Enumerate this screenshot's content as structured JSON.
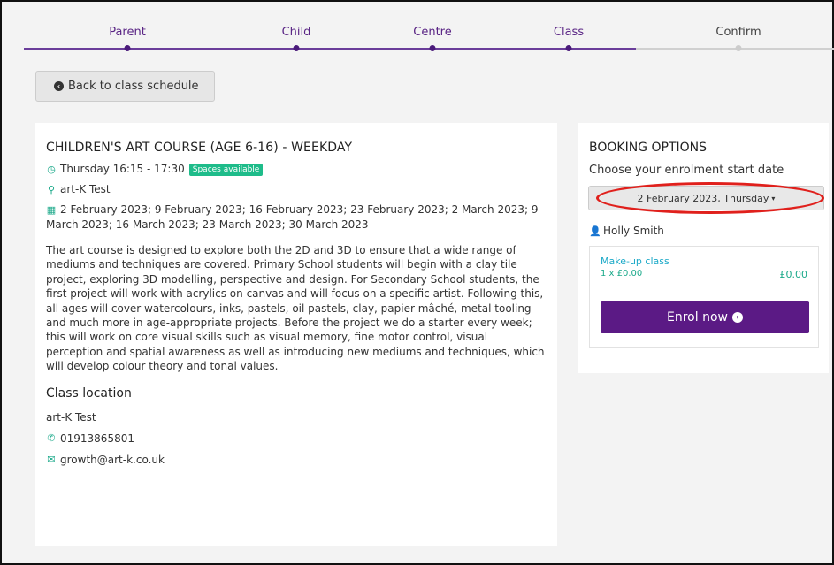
{
  "stepper": {
    "steps": [
      {
        "label": "Parent"
      },
      {
        "label": "Child"
      },
      {
        "label": "Centre"
      },
      {
        "label": "Class"
      },
      {
        "label": "Confirm"
      }
    ]
  },
  "back_button": {
    "label": "Back to class schedule"
  },
  "course": {
    "title": "CHILDREN'S ART COURSE (AGE 6-16) - WEEKDAY",
    "time": "Thursday 16:15 - 17:30",
    "availability": "Spaces available",
    "venue": "art-K Test",
    "dates": "2 February 2023; 9 February 2023; 16 February 2023; 23 February 2023; 2 March 2023; 9 March 2023; 16 March 2023; 23 March 2023; 30 March 2023",
    "description": "The art course is designed to explore both the 2D and 3D to ensure that a wide range of mediums and techniques are covered. Primary School students will begin with a clay tile project, exploring 3D modelling, perspective and design. For Secondary School students, the first project will work with acrylics on canvas and will focus on a specific artist. Following this, all ages will cover watercolours, inks, pastels, oil pastels, clay, papier mâché, metal tooling and much more in age-appropriate projects. Before the project we do a starter every week; this will work on core visual skills such as visual memory, fine motor control, visual perception and spatial awareness as well as introducing new mediums and techniques, which will develop colour theory and tonal values."
  },
  "location": {
    "heading": "Class location",
    "name": "art-K Test",
    "phone": "01913865801",
    "email": "growth@art-k.co.uk"
  },
  "booking": {
    "title": "BOOKING OPTIONS",
    "subtitle": "Choose your enrolment start date",
    "selected_date": "2 February 2023, Thursday",
    "student": "Holly Smith",
    "option_title": "Make-up class",
    "option_qty": "1 x £0.00",
    "option_amount": "£0.00",
    "enrol_label": "Enrol now"
  },
  "colors": {
    "accent": "#5b1a85",
    "teal": "#1ba98a",
    "highlight": "#e0201c"
  }
}
